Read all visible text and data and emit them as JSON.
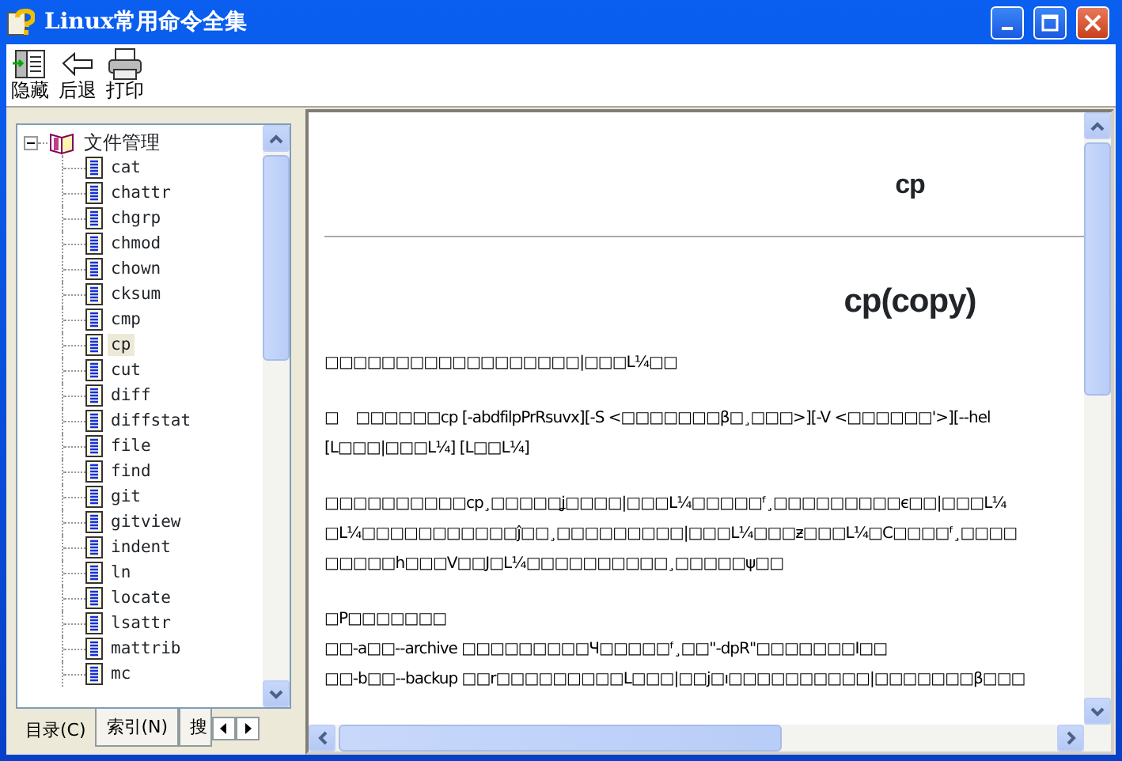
{
  "window": {
    "title": "Linux常用命令全集"
  },
  "toolbar": [
    {
      "label": "隐藏",
      "kind": "hide"
    },
    {
      "label": "后退",
      "kind": "back"
    },
    {
      "label": "打印",
      "kind": "print"
    }
  ],
  "tree": {
    "label": "文件管理",
    "expanded": true,
    "children": [
      {
        "label": "cat",
        "selected": false
      },
      {
        "label": "chattr",
        "selected": false
      },
      {
        "label": "chgrp",
        "selected": false
      },
      {
        "label": "chmod",
        "selected": false
      },
      {
        "label": "chown",
        "selected": false
      },
      {
        "label": "cksum",
        "selected": false
      },
      {
        "label": "cmp",
        "selected": false
      },
      {
        "label": "cp",
        "selected": true
      },
      {
        "label": "cut",
        "selected": false
      },
      {
        "label": "diff",
        "selected": false
      },
      {
        "label": "diffstat",
        "selected": false
      },
      {
        "label": "file",
        "selected": false
      },
      {
        "label": "find",
        "selected": false
      },
      {
        "label": "git",
        "selected": false
      },
      {
        "label": "gitview",
        "selected": false
      },
      {
        "label": "indent",
        "selected": false
      },
      {
        "label": "ln",
        "selected": false
      },
      {
        "label": "locate",
        "selected": false
      },
      {
        "label": "lsattr",
        "selected": false
      },
      {
        "label": "mattrib",
        "selected": false
      },
      {
        "label": "mc",
        "selected": false
      }
    ]
  },
  "tabs": [
    {
      "label": "目录(C)",
      "selected": true
    },
    {
      "label": "索引(N)",
      "selected": false
    },
    {
      "label": "搜",
      "selected": false
    }
  ],
  "content": {
    "heading": "cp",
    "title": "cp(copy)",
    "paragraphs": [
      [
        "□□□□□□□□□□□□□□□□□□|□□□L¼□□"
      ],
      [
        "□    □□□□□□cp [-abdfilpPrRsuvx][-S <□□□□□□□β□¸□□□>][-V <□□□□□□'>][--hel",
        "[L□□□|□□□L¼] [L□□L¼]"
      ],
      [
        "□□□□□□□□□□cp¸□□□□□ʝ□□□□|□□□L¼□□□□□ᶠ¸□□□□□□□□□є□□|□□□L¼",
        "□L¼□□□□□□□□□□□ĵ□□¸□□□□□□□□□|□□□L¼□□□ƶ□□□L¼□C□□□□ᶠ¸□□□□",
        "□□□□□h□□□V□□J□L¼□□□□□□□□□□¸□□□□□ψ□□"
      ],
      [
        "□P□□□□□□□",
        "□□-a□□--archive □□□□□□□□□Ч□□□□□ᶠ¸□□\"-dpR\"□□□□□□□I□□",
        "□□-b□□--backup □□r□□□□□□□□□L□□□|□□j□ı□□□□□□□□□□|□□□□□□□β□□□"
      ]
    ]
  }
}
